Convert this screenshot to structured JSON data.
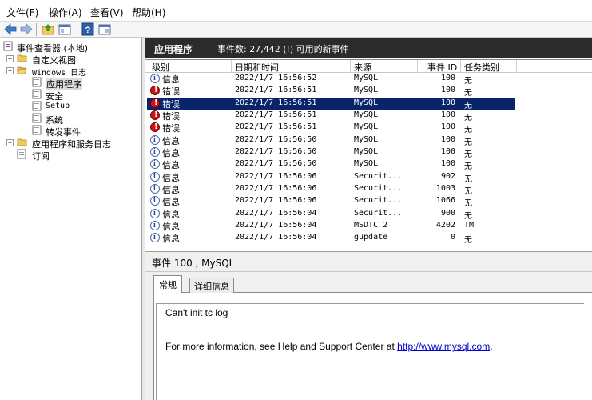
{
  "menu": [
    {
      "label": "文件(F)"
    },
    {
      "label": "操作(A)"
    },
    {
      "label": "查看(V)"
    },
    {
      "label": "帮助(H)"
    }
  ],
  "toolbar": {
    "icons": [
      "back-arrow-icon",
      "forward-arrow-icon",
      "up-folder-icon",
      "show-hide-tree-icon",
      "help-icon",
      "properties-icon"
    ]
  },
  "tree": {
    "root": "事件查看器 (本地)",
    "custom_views": "自定义视图",
    "windows_logs": "Windows 日志",
    "application": "应用程序",
    "security": "安全",
    "setup": "Setup",
    "system": "系统",
    "forwarded": "转发事件",
    "app_services": "应用程序和服务日志",
    "subscriptions": "订阅"
  },
  "header": {
    "title": "应用程序",
    "summary": "事件数: 27,442 (!) 可用的新事件"
  },
  "grid": {
    "columns": {
      "level": "级别",
      "datetime": "日期和时间",
      "source": "来源",
      "event_id": "事件 ID",
      "category": "任务类别"
    },
    "rows": [
      {
        "level": "信息",
        "type": "info",
        "datetime": "2022/1/7 16:56:52",
        "source": "MySQL",
        "event_id": "100",
        "category": "无"
      },
      {
        "level": "错误",
        "type": "err",
        "datetime": "2022/1/7 16:56:51",
        "source": "MySQL",
        "event_id": "100",
        "category": "无"
      },
      {
        "level": "错误",
        "type": "err",
        "datetime": "2022/1/7 16:56:51",
        "source": "MySQL",
        "event_id": "100",
        "category": "无",
        "selected": true
      },
      {
        "level": "错误",
        "type": "err",
        "datetime": "2022/1/7 16:56:51",
        "source": "MySQL",
        "event_id": "100",
        "category": "无"
      },
      {
        "level": "错误",
        "type": "err",
        "datetime": "2022/1/7 16:56:51",
        "source": "MySQL",
        "event_id": "100",
        "category": "无"
      },
      {
        "level": "信息",
        "type": "info",
        "datetime": "2022/1/7 16:56:50",
        "source": "MySQL",
        "event_id": "100",
        "category": "无"
      },
      {
        "level": "信息",
        "type": "info",
        "datetime": "2022/1/7 16:56:50",
        "source": "MySQL",
        "event_id": "100",
        "category": "无"
      },
      {
        "level": "信息",
        "type": "info",
        "datetime": "2022/1/7 16:56:50",
        "source": "MySQL",
        "event_id": "100",
        "category": "无"
      },
      {
        "level": "信息",
        "type": "info",
        "datetime": "2022/1/7 16:56:06",
        "source": "Securit...",
        "event_id": "902",
        "category": "无"
      },
      {
        "level": "信息",
        "type": "info",
        "datetime": "2022/1/7 16:56:06",
        "source": "Securit...",
        "event_id": "1003",
        "category": "无"
      },
      {
        "level": "信息",
        "type": "info",
        "datetime": "2022/1/7 16:56:06",
        "source": "Securit...",
        "event_id": "1066",
        "category": "无"
      },
      {
        "level": "信息",
        "type": "info",
        "datetime": "2022/1/7 16:56:04",
        "source": "Securit...",
        "event_id": "900",
        "category": "无"
      },
      {
        "level": "信息",
        "type": "info",
        "datetime": "2022/1/7 16:56:04",
        "source": "MSDTC 2",
        "event_id": "4202",
        "category": "TM"
      },
      {
        "level": "信息",
        "type": "info",
        "datetime": "2022/1/7 16:56:04",
        "source": "gupdate",
        "event_id": "0",
        "category": "无"
      }
    ]
  },
  "details": {
    "title": "事件 100 , MySQL",
    "tab_general": "常规",
    "tab_details": "详细信息",
    "line1": "Can't init tc log",
    "line2_prefix": "For more information, see Help and Support Center at ",
    "link": "http://www.mysql.com",
    "line2_suffix": "."
  }
}
